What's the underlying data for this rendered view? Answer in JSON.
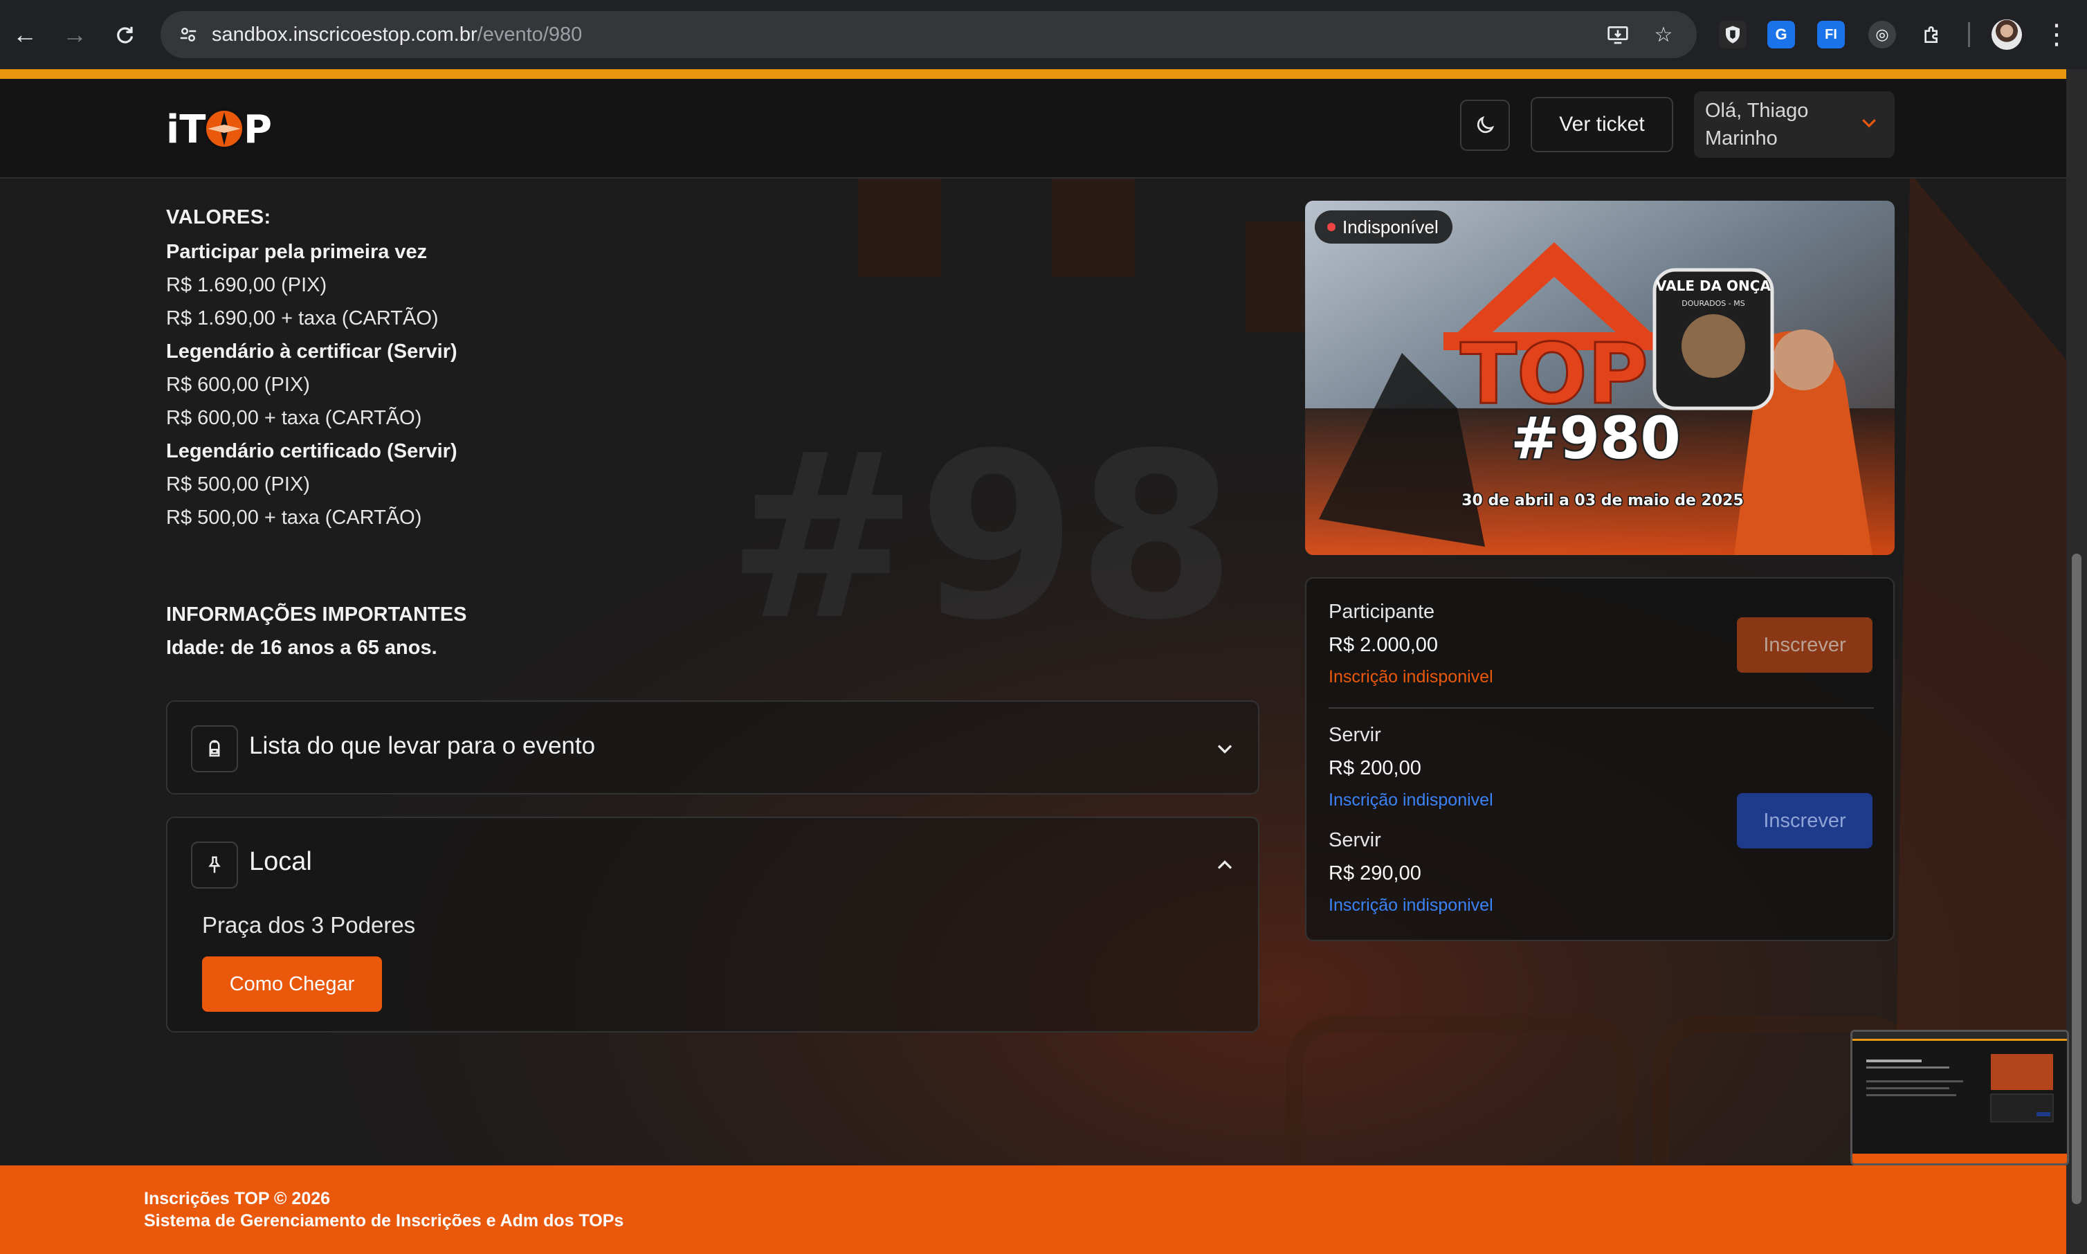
{
  "browser": {
    "url_host": "sandbox.inscricoestop.com.br",
    "url_path": "/evento/980",
    "back_icon": "arrow-left-icon",
    "forward_icon": "arrow-right-icon",
    "reload_icon": "reload-icon",
    "extensions": [
      "shield-extension",
      "translate-extension",
      "fi-extension",
      "globe-extension",
      "puzzle-extension"
    ]
  },
  "header": {
    "logo_text": "iTOP",
    "theme_toggle_icon": "moon-icon",
    "ver_ticket_label": "Ver ticket",
    "user_greeting_line1": "Olá, Thiago",
    "user_greeting_line2": "Marinho"
  },
  "valores": {
    "title": "VALORES:",
    "lines": [
      {
        "text": "Participar pela primeira vez",
        "bold": true
      },
      {
        "text": "R$ 1.690,00 (PIX)",
        "bold": false
      },
      {
        "text": "R$ 1.690,00 + taxa (CARTÃO)",
        "bold": false
      },
      {
        "text": "Legendário à certificar (Servir)",
        "bold": true
      },
      {
        "text": "R$ 600,00 (PIX)",
        "bold": false
      },
      {
        "text": "R$ 600,00 + taxa (CARTÃO)",
        "bold": false
      },
      {
        "text": "Legendário certificado (Servir)",
        "bold": true
      },
      {
        "text": "R$ 500,00 (PIX)",
        "bold": false
      },
      {
        "text": "R$ 500,00 + taxa (CARTÃO)",
        "bold": false
      }
    ]
  },
  "info": {
    "title": "INFORMAÇÕES IMPORTANTES",
    "age": "Idade: de 16 anos a 65 anos."
  },
  "accordions": {
    "lista": {
      "title": "Lista do que levar para o evento",
      "icon": "backpack-icon",
      "expanded": false
    },
    "local": {
      "title": "Local",
      "icon": "pin-icon",
      "expanded": true,
      "address": "Praça dos 3 Poderes",
      "button_label": "Como Chegar"
    }
  },
  "event_image": {
    "status": "Indisponível",
    "badge_text": "VALE DA ONÇA",
    "badge_subtext": "DOURADOS - MS",
    "big_title": "TOP",
    "number": "#980",
    "dates": "30 de abril a 03 de maio de 2025"
  },
  "tickets": [
    {
      "name": "Participante",
      "price": "R$ 2.000,00",
      "status": "Inscrição indisponivel",
      "color": "#ea580c"
    },
    {
      "name": "Servir",
      "price": "R$ 200,00",
      "status": "Inscrição indisponivel",
      "color": "#3b82f6"
    },
    {
      "name": "Servir",
      "price": "R$ 290,00",
      "status": "Inscrição indisponivel",
      "color": "#3b82f6"
    }
  ],
  "ticket_buttons": {
    "participante": "Inscrever",
    "servir": "Inscrever"
  },
  "footer": {
    "copyright": "Inscrições TOP © 2026",
    "description": "Sistema de Gerenciamento de Inscrições e Adm dos TOPs"
  },
  "colors": {
    "accent": "#ea580c",
    "header_bar": "#e8960c",
    "servir_blue": "#1e3a8a"
  }
}
